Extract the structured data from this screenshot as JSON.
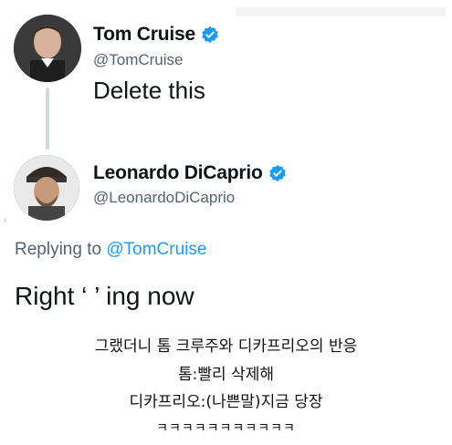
{
  "tweet1": {
    "name": "Tom Cruise",
    "handle": "@TomCruise",
    "text": "Delete this"
  },
  "tweet2": {
    "name": "Leonardo DiCaprio",
    "handle": "@LeonardoDiCaprio",
    "replying_prefix": "Replying to ",
    "replying_mention": "@TomCruise",
    "text": "Right ‘ ’ ing now"
  },
  "caption": {
    "line1": "그랬더니 톰 크루주와 디카프리오의 반응",
    "line2": "톰:빨리 삭제해",
    "line3": "디카프리오:(나쁜말)지금 당장",
    "line4": "ㅋㅋㅋㅋㅋㅋㅋㅋㅋㅋㅋ"
  },
  "colors": {
    "verified": "#1d9bf0",
    "mention": "#1d9bf0",
    "secondary_text": "#536471"
  },
  "icons": {
    "verified": "verified-badge-icon"
  }
}
